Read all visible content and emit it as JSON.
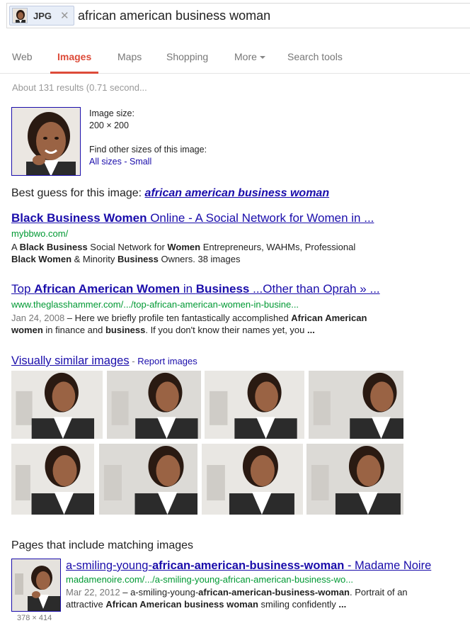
{
  "search": {
    "chip_label": "JPG",
    "chip_close": "✕",
    "query": "african american business woman"
  },
  "tabs": [
    {
      "label": "Web"
    },
    {
      "label": "Images"
    },
    {
      "label": "Maps"
    },
    {
      "label": "Shopping"
    },
    {
      "label": "More"
    },
    {
      "label": "Search tools"
    }
  ],
  "results_stats": "About 131 results (0.71 second...",
  "image_info": {
    "size_label": "Image size:",
    "size_value": "200 × 200",
    "other_sizes_label": "Find other sizes of this image:",
    "all_sizes": "All sizes",
    "separator": "-",
    "small": "Small"
  },
  "best_guess": {
    "label": "Best guess for this image:",
    "link": "african american business woman"
  },
  "results": [
    {
      "title_parts": [
        "Black Business Women",
        " Online - A Social Network for Women in ..."
      ],
      "url": "mybbwo.com/",
      "snippet_line1_parts": [
        "A ",
        "Black Business",
        " Social Network for ",
        "Women",
        " Entrepreneurs, WAHMs, Professional"
      ],
      "snippet_line2_parts": [
        "Black Women",
        " & Minority ",
        "Business",
        " Owners. 38 images"
      ]
    },
    {
      "title_parts": [
        "Top ",
        "African American Women",
        " in ",
        "Business",
        " ...Other than Oprah » ..."
      ],
      "url": "www.theglasshammer.com/.../top-african-american-women-in-busine...",
      "date": "Jan 24, 2008",
      "snippet_line1_parts": [
        " – Here we briefly profile ten fantastically accomplished ",
        "African American"
      ],
      "snippet_line2_parts": [
        "women",
        " in finance and ",
        "business",
        ". If you don't know their names yet, you ",
        "..."
      ]
    }
  ],
  "similar": {
    "title": "Visually similar images",
    "separator": "-",
    "report": "Report images"
  },
  "pages": {
    "heading": "Pages that include matching images",
    "thumb_dims": "378 × 414",
    "title_parts": [
      "a-smiling-young-",
      "african-american-business-woman",
      " - Madame Noire"
    ],
    "url": "madamenoire.com/.../a-smiling-young-african-american-business-wo...",
    "date": "Mar 22, 2012",
    "snippet_line1_parts": [
      " – a-smiling-young-",
      "african-american-business-woman",
      ". Portrait of an"
    ],
    "snippet_line2_parts": [
      "attractive ",
      "African American business woman",
      " smiling confidently ",
      "..."
    ]
  },
  "colors": {
    "link": "#1a0dab",
    "url_green": "#009933",
    "active_tab": "#dd4b39",
    "skin": "#9a6344",
    "hair": "#2a1a12",
    "suit": "#2b2b2b",
    "shirt": "#ffffff"
  },
  "icons": [
    "jpg-thumbnail-icon",
    "close-icon",
    "chevron-down-icon"
  ]
}
